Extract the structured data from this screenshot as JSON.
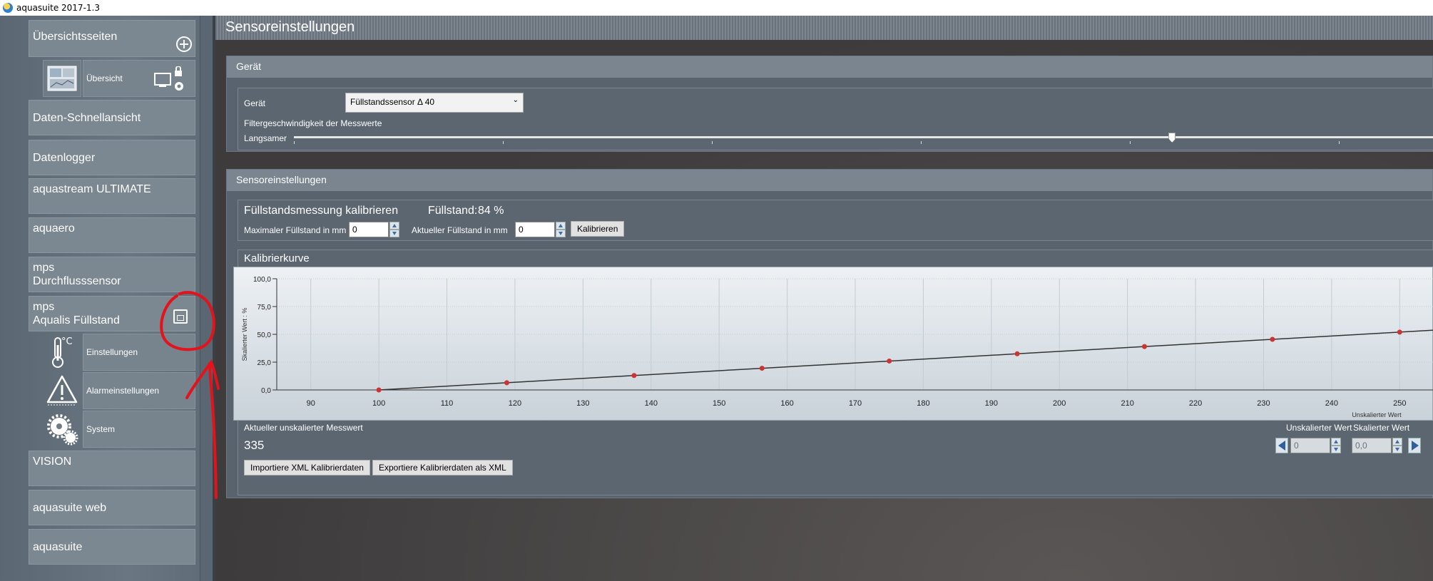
{
  "window": {
    "title": "aquasuite 2017-1.3"
  },
  "sidebar": {
    "overview_pages": "Übersichtsseiten",
    "overview_item": "Übersicht",
    "items": [
      "Daten-Schnellansicht",
      "Datenlogger",
      "aquastream ULTIMATE",
      "aquaero",
      {
        "line1": "mps",
        "line2": "Durchflusssensor"
      },
      {
        "line1": "mps",
        "line2": "Aqualis Füllstand"
      },
      "VISION",
      "aquasuite web",
      "aquasuite"
    ],
    "sub_items": [
      "Einstellungen",
      "Alarmeinstellungen",
      "System"
    ],
    "temp_unit": "°C"
  },
  "main": {
    "title": "Sensoreinstellungen",
    "device_group": {
      "header": "Gerät",
      "device_label": "Gerät",
      "device_value": "Füllstandssensor Δ 40",
      "filter_label": "Filtergeschwindigkeit der Messwerte",
      "slower_label": "Langsamer",
      "filter_level": 0.77
    },
    "sensor_group": {
      "header": "Sensoreinstellungen",
      "calibrate_title": "Füllstandsmessung kalibrieren",
      "level_label": "Füllstand:",
      "level_value": "84 %",
      "max_label": "Maximaler Füllstand in mm",
      "max_value": "0",
      "current_label": "Aktueller Füllstand in mm",
      "current_value": "0",
      "calibrate_button": "Kalibrieren",
      "curve_title": "Kalibrierkurve",
      "raw_label": "Aktueller unskalierter Messwert",
      "raw_value": "335",
      "import_button": "Importiere XML Kalibrierdaten",
      "export_button": "Exportiere Kalibrierdaten als XML",
      "unscaled_header": "Unskalierter Wert",
      "scaled_header": "Skalierter Wert",
      "unscaled_value": "0",
      "scaled_value": "0,0"
    }
  },
  "chart_data": {
    "type": "line",
    "xlabel": "Unskalierter Wert",
    "ylabel": "Skalierter Wert : %",
    "xlim": [
      85,
      255
    ],
    "ylim": [
      0,
      100
    ],
    "x_ticks": [
      "90",
      "100",
      "110",
      "120",
      "130",
      "140",
      "150",
      "160",
      "170",
      "180",
      "190",
      "200",
      "210",
      "220",
      "230",
      "240",
      "250"
    ],
    "y_ticks": [
      "0,0",
      "25,0",
      "50,0",
      "75,0",
      "100,0"
    ],
    "series": [
      {
        "color": "#cc3333",
        "points": [
          [
            100,
            0.0
          ],
          [
            118.8,
            6.5
          ],
          [
            137.5,
            13.0
          ],
          [
            156.3,
            19.5
          ],
          [
            175.0,
            26.0
          ],
          [
            193.8,
            32.5
          ],
          [
            212.5,
            39.0
          ],
          [
            231.3,
            45.5
          ],
          [
            250.0,
            52.0
          ]
        ]
      }
    ]
  },
  "colors": {
    "annotation": "#e3121b",
    "accent": "#2f5f9e"
  }
}
